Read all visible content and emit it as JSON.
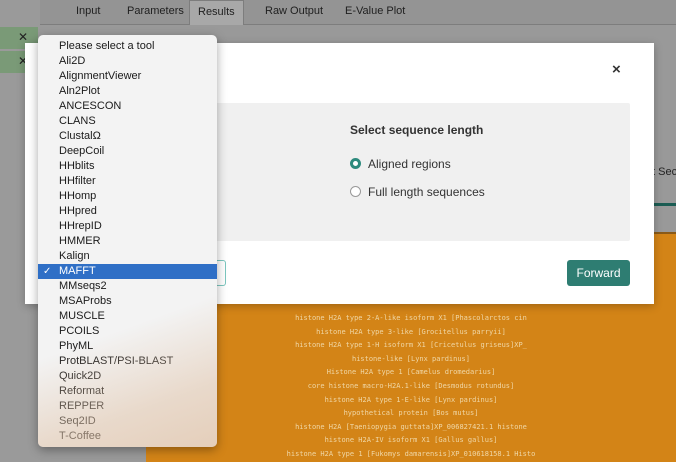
{
  "tabs": [
    "Input",
    "Parameters",
    "Results",
    "Raw Output",
    "E-Value Plot"
  ],
  "active_tab": "Results",
  "background_partial_text": "t Sec",
  "alignment_labels": [
    "histone H2A type 2-A-like isoform X1 [Phascolarctos cin",
    "histone H2A type 3-like [Grocitellus parryii]",
    "histone H2A type 1-H isoform X1 [Cricetulus griseus]XP_",
    "histone-like [Lynx pardinus]",
    "Histone H2A type 1 [Camelus dromedarius]",
    "core histone macro-H2A.1-like [Desmodus rotundus]",
    "histone H2A type 1-E-like [Lynx pardinus]",
    "hypothetical protein [Bos mutus]",
    "histone H2A [Taeniopygia guttata]XP_006827421.1 histone",
    "histone H2A-IV isoform X1 [Gallus gallus]",
    "histone H2A type 1 [Fukomys damarensis]XP_010618158.1 Histo"
  ],
  "modal": {
    "close_label": "×",
    "panel_title": "Select sequence length",
    "options": [
      {
        "label": "Aligned regions",
        "checked": true
      },
      {
        "label": "Full length sequences",
        "checked": false
      }
    ],
    "forward_label": "Forward"
  },
  "dropdown": {
    "checkmark": "✓",
    "selected": "MAFFT",
    "items": [
      "Please select a tool",
      "Ali2D",
      "AlignmentViewer",
      "Aln2Plot",
      "ANCESCON",
      "CLANS",
      "ClustalΩ",
      "DeepCoil",
      "HHblits",
      "HHfilter",
      "HHomp",
      "HHpred",
      "HHrepID",
      "HMMER",
      "Kalign",
      "MAFFT",
      "MMseqs2",
      "MSAProbs",
      "MUSCLE",
      "PCOILS",
      "PhyML",
      "ProtBLAST/PSI-BLAST",
      "Quick2D",
      "Reformat",
      "REPPER",
      "Seq2ID",
      "T-Coffee"
    ]
  },
  "colors": {
    "accent": "#2e7d72",
    "selection": "#2f6fc6",
    "alignment": "#d38417"
  }
}
